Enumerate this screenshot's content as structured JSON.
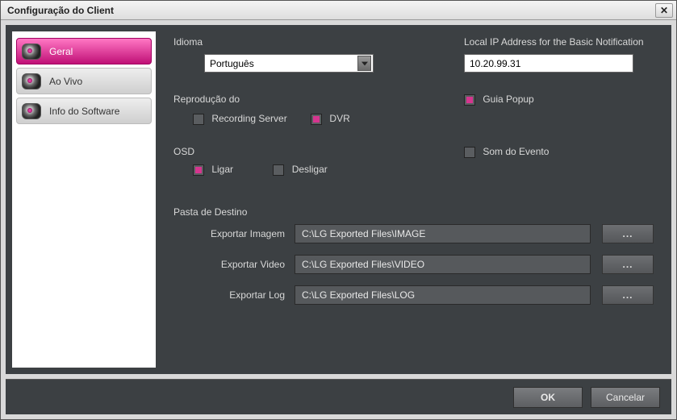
{
  "title": "Configuração do Client",
  "sidebar": {
    "items": [
      {
        "label": "Geral"
      },
      {
        "label": "Ao Vivo"
      },
      {
        "label": "Info do Software"
      }
    ],
    "activeIndex": 0
  },
  "language": {
    "label": "Idioma",
    "selected": "Português"
  },
  "ip": {
    "label": "Local IP Address for the Basic Notification",
    "value": "10.20.99.31"
  },
  "reproduction": {
    "label": "Reprodução do",
    "options": {
      "recordingServer": {
        "label": "Recording Server",
        "checked": false
      },
      "dvr": {
        "label": "DVR",
        "checked": true
      }
    }
  },
  "guidePopup": {
    "label": "Guia Popup",
    "checked": true
  },
  "osd": {
    "label": "OSD",
    "on": {
      "label": "Ligar",
      "checked": true
    },
    "off": {
      "label": "Desligar",
      "checked": false
    }
  },
  "eventSound": {
    "label": "Som do Evento",
    "checked": false
  },
  "dest": {
    "label": "Pasta de Destino",
    "rows": [
      {
        "label": "Exportar Imagem",
        "path": "C:\\LG Exported Files\\IMAGE"
      },
      {
        "label": "Exportar Video",
        "path": "C:\\LG Exported Files\\VIDEO"
      },
      {
        "label": "Exportar Log",
        "path": "C:\\LG Exported Files\\LOG"
      }
    ],
    "browseLabel": "..."
  },
  "buttons": {
    "ok": "OK",
    "cancel": "Cancelar"
  }
}
